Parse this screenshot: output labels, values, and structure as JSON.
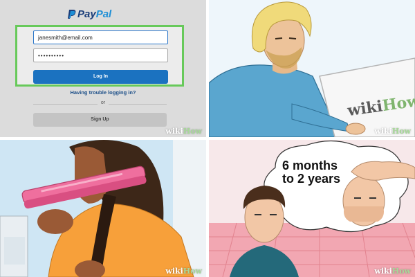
{
  "login": {
    "brand_part1": "Pay",
    "brand_part2": "Pal",
    "email_value": "janesmith@email.com",
    "password_value": "••••••••••",
    "login_button": "Log In",
    "trouble_link": "Having trouble logging in?",
    "divider_text": "or",
    "signup_button": "Sign Up"
  },
  "watermark": {
    "part1": "wiki",
    "part2": "How"
  },
  "bubble": {
    "line1": "6 months",
    "line2": "to 2 years"
  },
  "colors": {
    "highlight": "#67c95a",
    "login_button": "#1b72c0",
    "hair_straightener": "#ef6f9e"
  }
}
